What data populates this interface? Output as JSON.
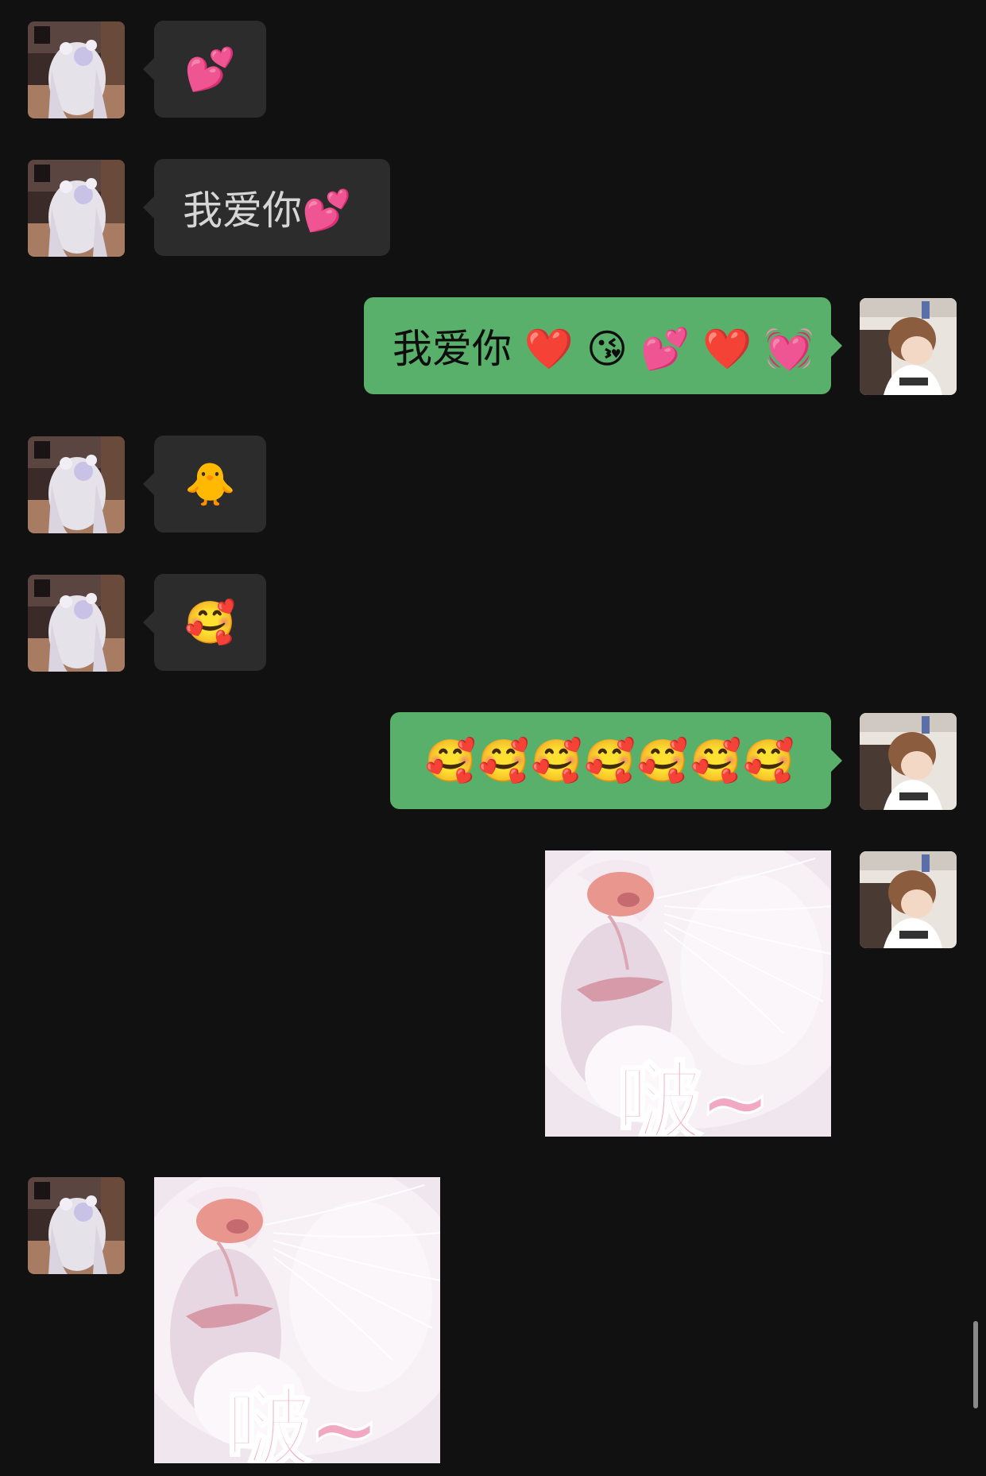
{
  "messages": [
    {
      "sender": "her",
      "text": "💕"
    },
    {
      "sender": "her",
      "text": "我爱你💕"
    },
    {
      "sender": "me",
      "text": "我爱你 ❤️ 😘 💕 ❤️ 💓"
    },
    {
      "sender": "her",
      "text": "🐥"
    },
    {
      "sender": "her",
      "text": "🥰"
    },
    {
      "sender": "me",
      "text": "🥰🥰🥰🥰🥰🥰🥰"
    },
    {
      "sender": "me",
      "sticker_caption": "啵~"
    },
    {
      "sender": "her",
      "sticker_caption": "啵~"
    }
  ],
  "colors": {
    "background": "#111111",
    "incoming_bubble": "#2c2c2c",
    "outgoing_bubble": "#58b06a"
  }
}
